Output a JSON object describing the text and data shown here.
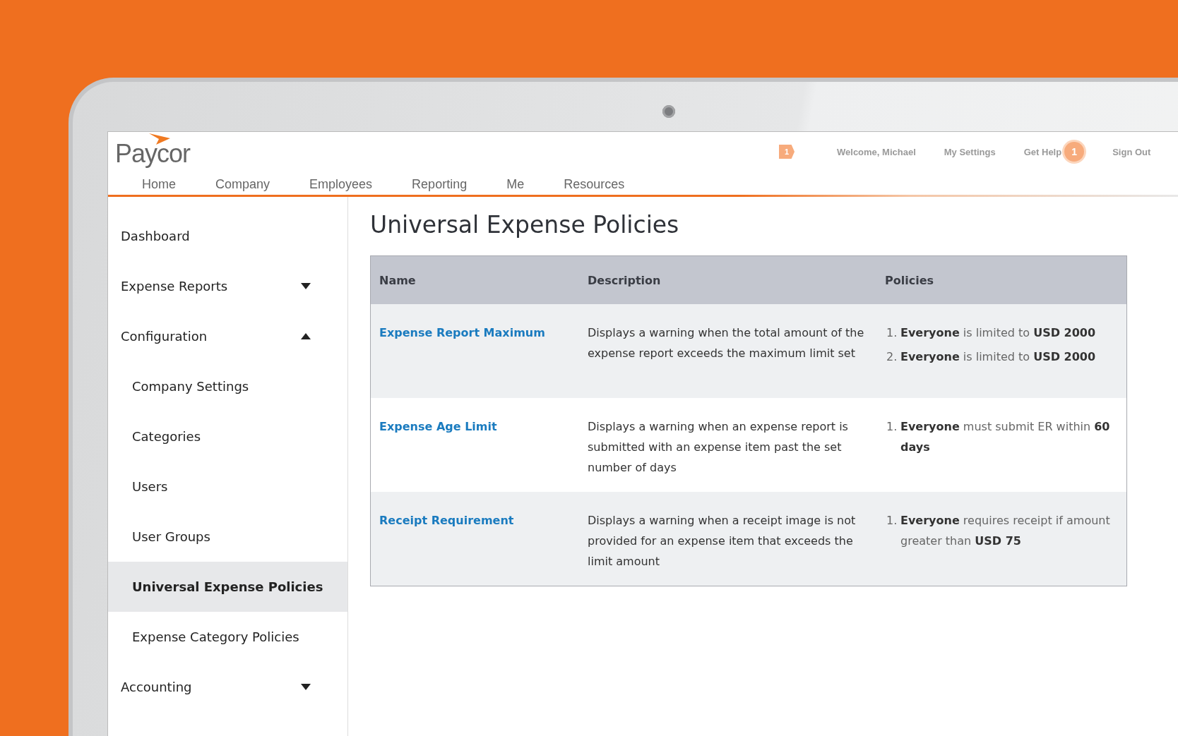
{
  "header": {
    "logo": "Paycor",
    "alert_count": "1",
    "links": [
      {
        "label": "Welcome, Michael"
      },
      {
        "label": "My Settings"
      },
      {
        "label": "Get Help",
        "badge": "1"
      },
      {
        "label": "Sign Out"
      }
    ]
  },
  "nav": {
    "tabs": [
      {
        "label": "Home"
      },
      {
        "label": "Company"
      },
      {
        "label": "Employees"
      },
      {
        "label": "Reporting"
      },
      {
        "label": "Me"
      },
      {
        "label": "Resources"
      }
    ]
  },
  "sidebar": {
    "items": [
      {
        "label": "Dashboard",
        "selected": false
      },
      {
        "label": "Expense Reports",
        "selected": false,
        "expanded": false
      },
      {
        "label": "Configuration",
        "selected": false,
        "expanded": true,
        "children": [
          {
            "label": "Company Settings",
            "selected": false
          },
          {
            "label": "Categories",
            "selected": false
          },
          {
            "label": "Users",
            "selected": false
          },
          {
            "label": "User Groups",
            "selected": false
          },
          {
            "label": "Universal Expense Policies",
            "selected": true
          },
          {
            "label": "Expense Category Policies",
            "selected": false
          }
        ]
      },
      {
        "label": "Accounting",
        "selected": false,
        "expanded": false
      }
    ]
  },
  "page": {
    "title": "Universal Expense Policies"
  },
  "table": {
    "columns": [
      "Name",
      "Description",
      "Policies"
    ],
    "rows": [
      {
        "name": "Expense Report Maximum",
        "description": "Displays a warning when the total amount of the expense report exceeds the maximum limit set",
        "policies": [
          {
            "number": "1.",
            "text": "**Everyone** is limited to **USD 2000**"
          },
          {
            "number": "2.",
            "text": "**Everyone** is limited to **USD 2000**"
          }
        ]
      },
      {
        "name": "Expense Age Limit",
        "description": "Displays a warning when an expense report is submitted with an expense item past the set number of days",
        "policies": [
          {
            "number": "1.",
            "text": "**Everyone** must submit ER within **60 days**"
          }
        ]
      },
      {
        "name": "Receipt Requirement",
        "description": "Displays a warning when a receipt image is not provided for an expense item that exceeds the limit amount",
        "policies": [
          {
            "number": "1.",
            "text": "**Everyone** requires receipt if amount greater than **USD 75**"
          }
        ]
      }
    ]
  }
}
